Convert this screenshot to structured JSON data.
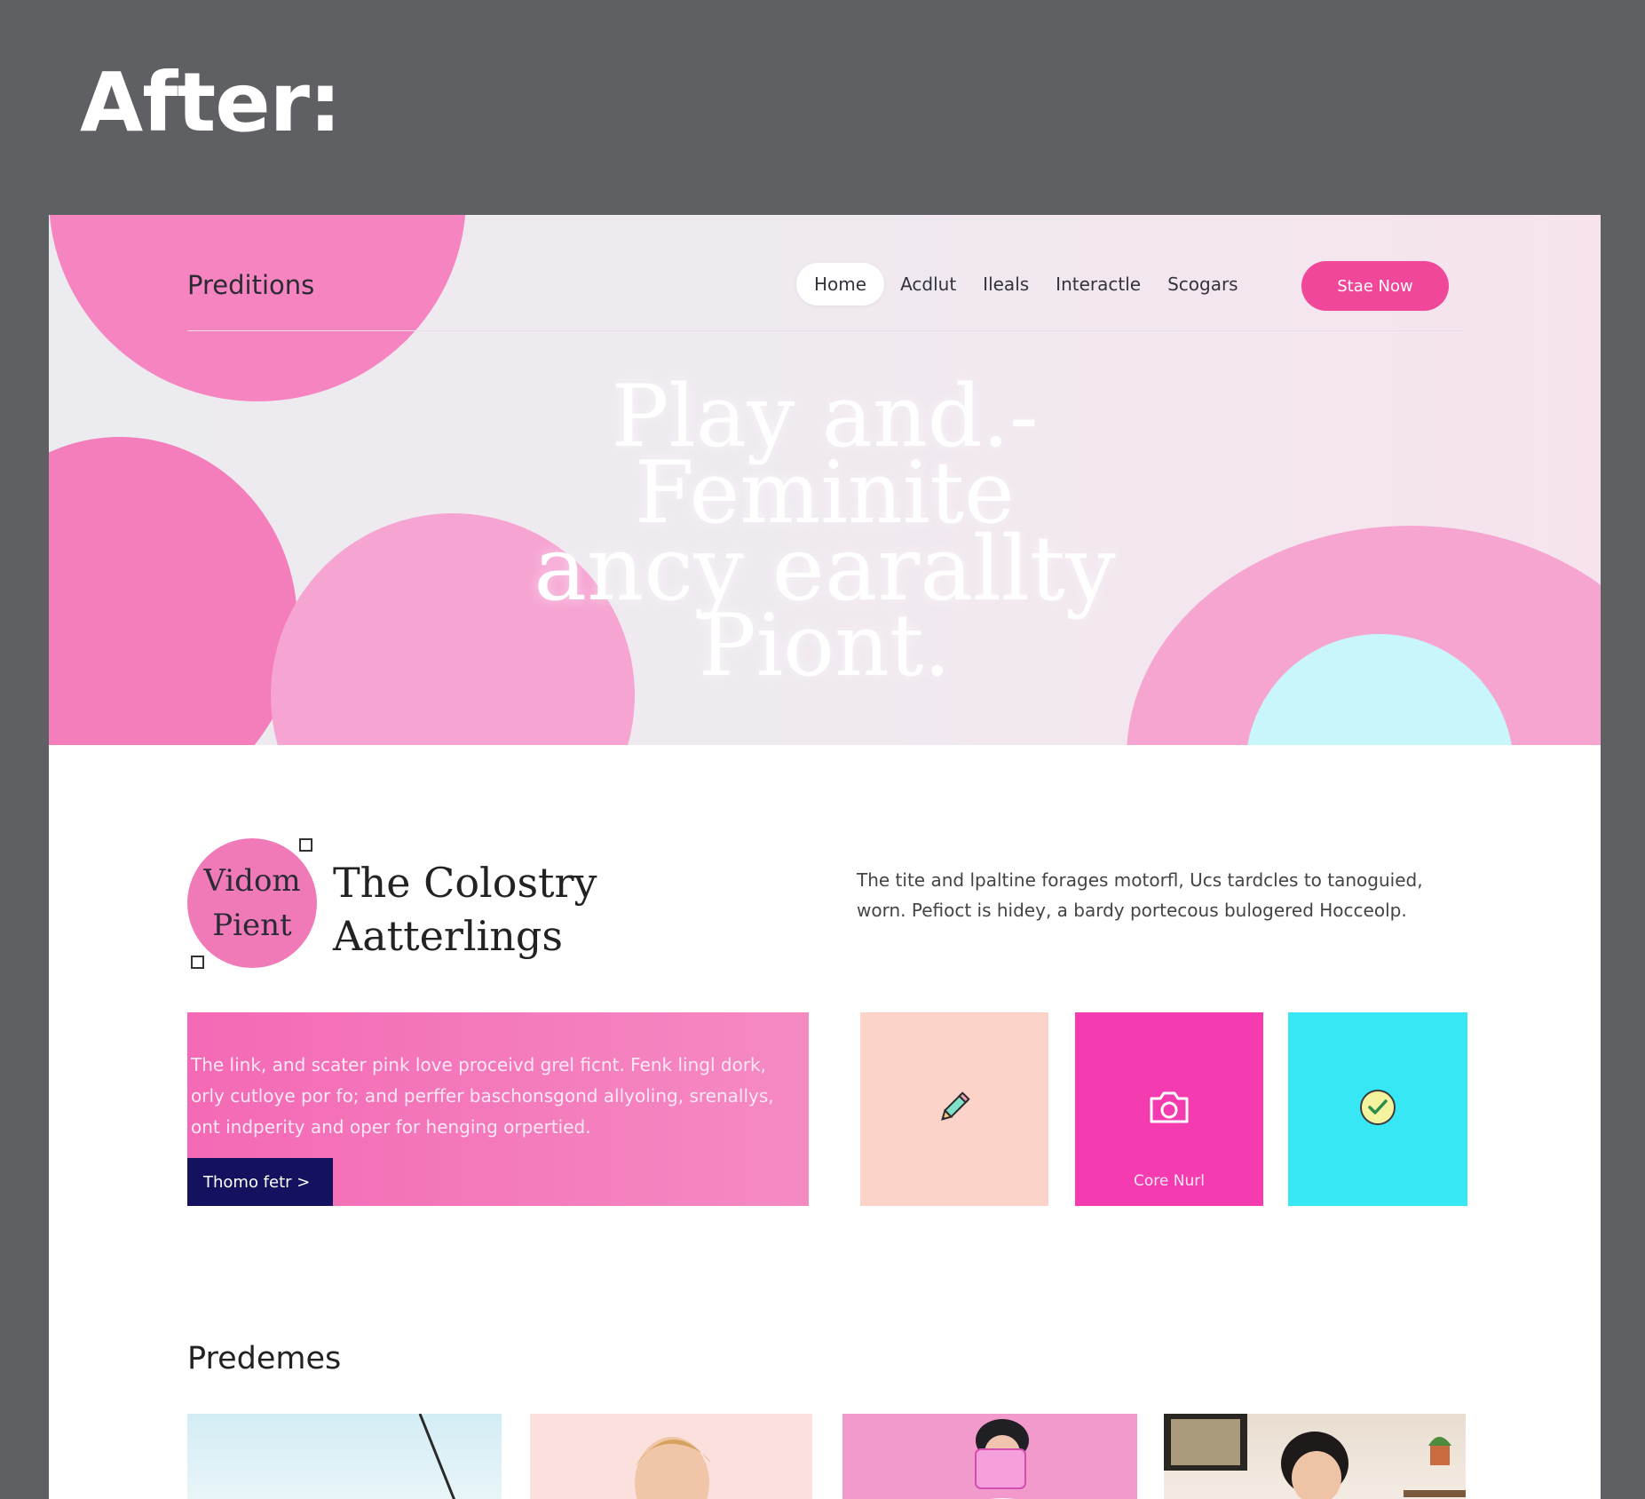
{
  "caption": "After:",
  "header": {
    "brand": "Preditions",
    "nav": [
      "Home",
      "Acdlut",
      "Ileals",
      "Interactle",
      "Scogars"
    ],
    "cta": "Stae Now"
  },
  "hero": {
    "headline_lines": [
      "Play and.-",
      "Feminite",
      "ancy earallty",
      "Piont."
    ]
  },
  "section": {
    "badge_lines": [
      "Vidom",
      "Pient"
    ],
    "title_lines": [
      "The Colostry",
      "Aatterlings"
    ],
    "description": "The tite and lpaltine forages motorfl, Ucs tardcles to tanoguied, worn. Pefioct is hidey, a bardy portecous bulogered Hocceolp."
  },
  "promo": {
    "text": "The link, and scater pink love proceivd grel ficnt. Fenk lingl dork, orly cutloye por fo; and perffer baschonsgond allyoling, srenallys, ont indperity and oper for henging orpertied.",
    "button": "Thomo fetr >"
  },
  "tiles": [
    {
      "icon": "pencil-icon",
      "label": ""
    },
    {
      "icon": "camera-icon",
      "label": "Core Nurl"
    },
    {
      "icon": "check-circle-icon",
      "label": ""
    }
  ],
  "gallery": {
    "title": "Predemes"
  },
  "colors": {
    "accent_pink": "#f0479a",
    "pink_light": "#f6a4d2",
    "cyan": "#37e8f4",
    "peach": "#fbd3c9",
    "navy": "#14125e"
  }
}
